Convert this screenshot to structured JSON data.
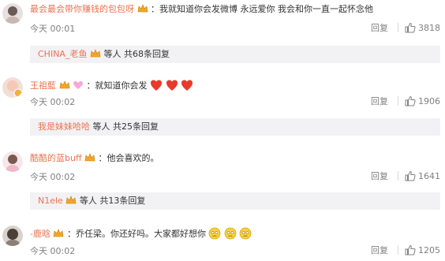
{
  "comments": [
    {
      "username": "最会最会带你赚钱的包包呀",
      "text": "：我就知道你会发微博  永远爱你  我会和你一直一起怀念他",
      "time": "今天 00:01",
      "reply_label": "回复",
      "likes": "3818",
      "replies": {
        "users": "CHINA_老鱼",
        "summary": "等人 共68条回复"
      }
    },
    {
      "username": "王祖藍",
      "text": "：就知道你会发",
      "time": "今天 00:02",
      "reply_label": "回复",
      "likes": "1906",
      "replies": {
        "users": "我是妹妹哈哈",
        "summary": "等人 共25条回复"
      }
    },
    {
      "username": "酷酷的蓝buff",
      "text": "：他会喜欢的。",
      "time": "今天 00:02",
      "reply_label": "回复",
      "likes": "1641",
      "replies": {
        "users": "N1ele",
        "summary": "等人 共13条回复"
      }
    },
    {
      "username": "-鹿晗",
      "text": "：乔任梁。你还好吗。大家都好想你",
      "time": "今天 00:02",
      "reply_label": "回复",
      "likes": "1205"
    }
  ],
  "colors": {
    "username": "#eb7350",
    "meta": "#808080",
    "reply_bg": "#f2f2f5",
    "heart": "#e8392b"
  },
  "icons": [
    "vip-crown-icon",
    "thumb-up-icon",
    "heart-emoji-icon",
    "sad-face-emoji-icon",
    "pink-heart-icon"
  ]
}
